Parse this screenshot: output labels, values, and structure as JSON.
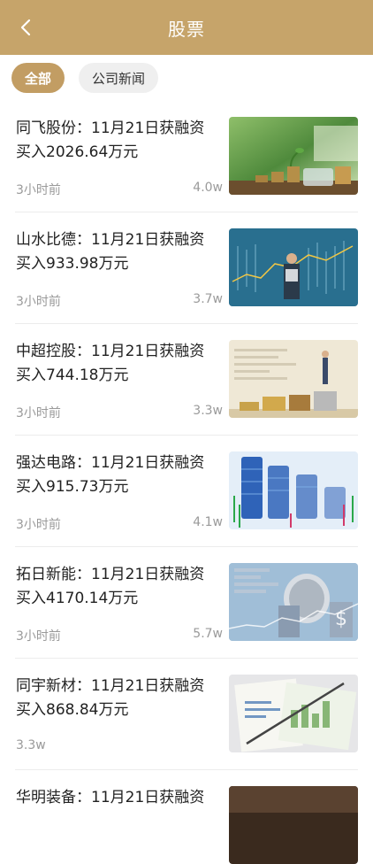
{
  "header": {
    "title": "股票",
    "back_icon": "chevron-left-icon"
  },
  "tabs": [
    {
      "label": "全部",
      "active": true
    },
    {
      "label": "公司新闻",
      "active": false
    }
  ],
  "articles": [
    {
      "title": "同飞股份：11月21日获融资买入2026.64万元",
      "time": "3小时前",
      "views": "4.0w",
      "image": "plant-coins-jar"
    },
    {
      "title": "山水比德：11月21日获融资买入933.98万元",
      "time": "3小时前",
      "views": "3.7w",
      "image": "businessman-stock-screen"
    },
    {
      "title": "中超控股：11月21日获融资买入744.18万元",
      "time": "3小时前",
      "views": "3.3w",
      "image": "figure-on-coin-stacks"
    },
    {
      "title": "强达电路：11月21日获融资买入915.73万元",
      "time": "3小时前",
      "views": "4.1w",
      "image": "blue-coin-stacks-chart"
    },
    {
      "title": "拓日新能：11月21日获融资买入4170.14万元",
      "time": "3小时前",
      "views": "5.7w",
      "image": "dollar-coins-graph"
    },
    {
      "title": "同宇新材：11月21日获融资买入868.84万元",
      "time": "",
      "views": "3.3w",
      "image": "documents-pen"
    },
    {
      "title": "华明装备：11月21日获融资",
      "time": "",
      "views": "",
      "image": "dark-photo"
    }
  ],
  "colors": {
    "brand": "#c6a46a",
    "tab_active": "#c29d63"
  }
}
